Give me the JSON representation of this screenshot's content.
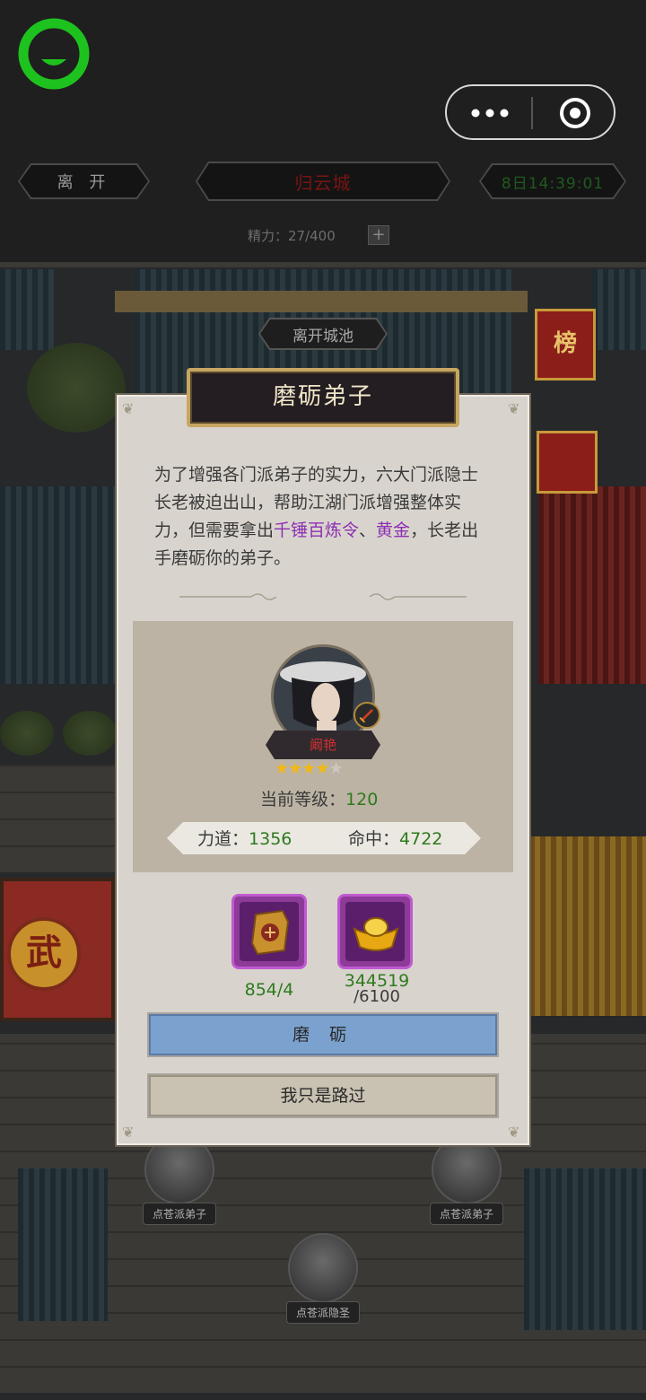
{
  "header": {
    "leave_label": "离 开",
    "city_name": "归云城",
    "clock": "8日14:39:01",
    "stamina_label": "精力：27/400",
    "plus": "+"
  },
  "map": {
    "leave_city_label": "离开城池",
    "banner_rank": "榜",
    "wu_sign": "武",
    "npcs": [
      {
        "label": "点苍派弟子"
      },
      {
        "label": "点苍派弟子"
      },
      {
        "label": "点苍派隐圣"
      }
    ]
  },
  "modal": {
    "title": "磨砺弟子",
    "desc_pre": "为了增强各门派弟子的实力，六大门派隐士长老被迫出山，帮助江湖门派增强整体实力，但需要拿出",
    "desc_hl1": "千锤百炼令",
    "desc_mid": "、",
    "desc_hl2": "黄金",
    "desc_post": "，长老出手磨砺你的弟子。",
    "hero": {
      "name": "阚艳",
      "stars_filled": 4,
      "stars_total": 5,
      "level_label": "当前等级：",
      "level_value": "120",
      "power_label": "力道：",
      "power_value": "1356",
      "hit_label": "命中：",
      "hit_value": "4722"
    },
    "items": [
      {
        "icon": "token-icon",
        "count": "854/4"
      },
      {
        "icon": "gold-ingot-icon",
        "count_have": "344519",
        "count_need": "/6100"
      }
    ],
    "primary_button": "磨 砺",
    "secondary_button": "我只是路过"
  },
  "colors": {
    "highlight": "#8e2fb3",
    "value_green": "#2e7a1e",
    "name_red": "#d03030",
    "primary_button": "#7ba2cf"
  }
}
